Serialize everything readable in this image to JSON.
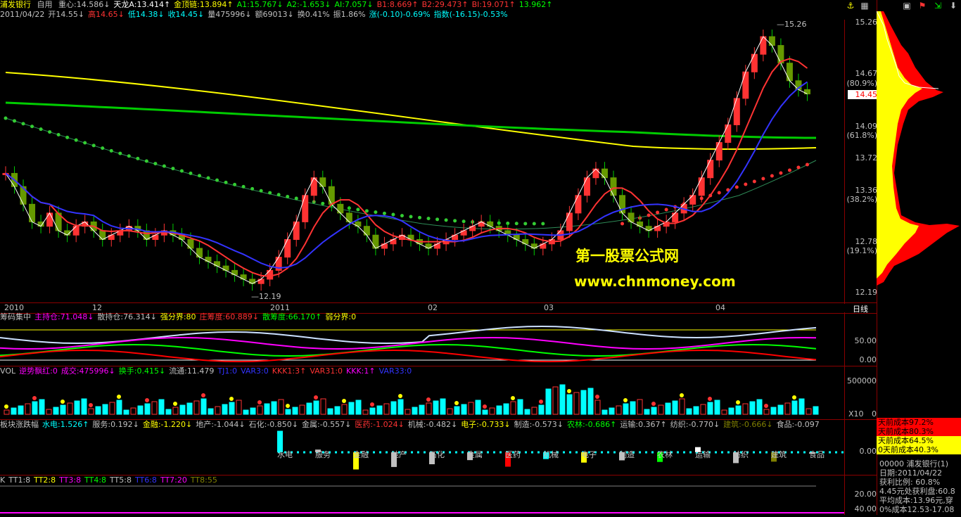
{
  "header1": {
    "stock_name": "浦发银行",
    "tab": "自用",
    "items": [
      {
        "label": "重心:14.586",
        "arrow": "↓",
        "color": "#c0c0c0"
      },
      {
        "label": "天龙A:13.414",
        "arrow": "↑",
        "color": "#ffffff"
      },
      {
        "label": "金顶链:13.894",
        "arrow": "↑",
        "color": "#ffff00"
      },
      {
        "label": "A1:15.767",
        "arrow": "↓",
        "color": "#00ff00"
      },
      {
        "label": "A2:-1.653",
        "arrow": "↓",
        "color": "#00ff00"
      },
      {
        "label": "AI:7.057",
        "arrow": "↓",
        "color": "#00ff00"
      },
      {
        "label": "B1:8.669",
        "arrow": "↑",
        "color": "#ff3333"
      },
      {
        "label": "B2:29.473",
        "arrow": "↑",
        "color": "#ff3333"
      },
      {
        "label": "BI:19.071",
        "arrow": "↑",
        "color": "#ff3333"
      },
      {
        "label": "13.962",
        "arrow": "↑",
        "color": "#00ff00"
      }
    ]
  },
  "header2": {
    "items": [
      {
        "label": "2011/04/22",
        "color": "#c0c0c0"
      },
      {
        "label": "开14.55↓",
        "color": "#c0c0c0"
      },
      {
        "label": "高14.65↓",
        "color": "#ff3333"
      },
      {
        "label": "低14.38↓",
        "color": "#00ffff"
      },
      {
        "label": "收14.45↓",
        "color": "#00ffff"
      },
      {
        "label": "量475996↓",
        "color": "#c0c0c0"
      },
      {
        "label": "额69013↓",
        "color": "#c0c0c0"
      },
      {
        "label": "换0.41%",
        "color": "#c0c0c0"
      },
      {
        "label": "振1.86%",
        "color": "#c0c0c0"
      },
      {
        "label": "涨(-0.10)-0.69%",
        "color": "#00ffff"
      },
      {
        "label": "指数(-16.15)-0.53%",
        "color": "#00ffff"
      }
    ]
  },
  "price_axis": [
    "15.26",
    "14.67",
    "(80.9%)",
    "14.45",
    "14.09",
    "(61.8%)",
    "13.72",
    "13.36",
    "(38.2%)",
    "12.78",
    "(19.1%)",
    "12.19"
  ],
  "price_markers": {
    "high": "15.26",
    "low": "12.19"
  },
  "date_axis": [
    "2010",
    "12",
    "2011",
    "02",
    "03",
    "04"
  ],
  "period_label": "日线",
  "watermark": {
    "line1": "第一股票公式网",
    "line2": "www.chnmoney.com"
  },
  "indicator1": {
    "items": [
      {
        "label": "筹码集中",
        "color": "#c0c0c0"
      },
      {
        "label": "主持仓:71.048↓",
        "color": "#ff00ff"
      },
      {
        "label": "散持仓:76.314↓",
        "color": "#c0c0c0"
      },
      {
        "label": "强分界:80",
        "color": "#ffff00"
      },
      {
        "label": "庄筹度:60.889↓",
        "color": "#ff3333"
      },
      {
        "label": "散筹度:66.170↑",
        "color": "#00ff00"
      },
      {
        "label": "弱分界:0",
        "color": "#ffff00"
      }
    ],
    "axis": [
      "50.00",
      "0.00"
    ]
  },
  "indicator2": {
    "items": [
      {
        "label": "VOL",
        "color": "#c0c0c0"
      },
      {
        "label": "逆势飘红:0",
        "color": "#ff00ff"
      },
      {
        "label": "成交:475996↓",
        "color": "#ff00ff"
      },
      {
        "label": "换手:0.415↓",
        "color": "#00ff00"
      },
      {
        "label": "流通:11.479",
        "color": "#c0c0c0"
      },
      {
        "label": "TJ1:0",
        "color": "#3333ff"
      },
      {
        "label": "VAR3:0",
        "color": "#3333ff"
      },
      {
        "label": "KKK1:3↑",
        "color": "#ff3333"
      },
      {
        "label": "VAR31:0",
        "color": "#ff3333"
      },
      {
        "label": "KKK:1↑",
        "color": "#ff00ff"
      },
      {
        "label": "VAR33:0",
        "color": "#3333ff"
      }
    ],
    "axis_top": "500000",
    "axis_unit": "X10",
    "axis_bottom": "0"
  },
  "indicator3": {
    "items": [
      {
        "label": "板块涨跌幅",
        "color": "#c0c0c0"
      },
      {
        "label": "水电:1.526↑",
        "color": "#00ffff"
      },
      {
        "label": "服务:0.192↓",
        "color": "#c0c0c0"
      },
      {
        "label": "金融:-1.220↓",
        "color": "#ffff00"
      },
      {
        "label": "地产:-1.044↓",
        "color": "#c0c0c0"
      },
      {
        "label": "石化:-0.850↓",
        "color": "#c0c0c0"
      },
      {
        "label": "金属:-0.557↓",
        "color": "#c0c0c0"
      },
      {
        "label": "医药:-1.024↓",
        "color": "#ff3333"
      },
      {
        "label": "机械:-0.482↓",
        "color": "#c0c0c0"
      },
      {
        "label": "电子:-0.733↓",
        "color": "#ffff00"
      },
      {
        "label": "制造:-0.573↓",
        "color": "#c0c0c0"
      },
      {
        "label": "农林:-0.686↑",
        "color": "#00ff00"
      },
      {
        "label": "运输:0.367↑",
        "color": "#c0c0c0"
      },
      {
        "label": "纺织:-0.770↓",
        "color": "#c0c0c0"
      },
      {
        "label": "建筑:-0.666↓",
        "color": "#808000"
      },
      {
        "label": "食品:-0.097",
        "color": "#c0c0c0"
      }
    ],
    "sectors": [
      {
        "name": "水电",
        "value": 1.526,
        "color": "#00ffff"
      },
      {
        "name": "服务",
        "value": 0.192,
        "color": "#c0c0c0"
      },
      {
        "name": "金融",
        "value": -1.22,
        "color": "#ffff00"
      },
      {
        "name": "地产",
        "value": -1.044,
        "color": "#c0c0c0"
      },
      {
        "name": "石化",
        "value": -0.85,
        "color": "#c0c0c0"
      },
      {
        "name": "金属",
        "value": -0.557,
        "color": "#c0c0c0"
      },
      {
        "name": "医药",
        "value": -1.024,
        "color": "#ff0000"
      },
      {
        "name": "机械",
        "value": -0.482,
        "color": "#00ffff"
      },
      {
        "name": "电子",
        "value": -0.733,
        "color": "#ffff00"
      },
      {
        "name": "制造",
        "value": -0.573,
        "color": "#c0c0c0"
      },
      {
        "name": "农林",
        "value": -0.686,
        "color": "#00ff00"
      },
      {
        "name": "运输",
        "value": 0.367,
        "color": "#ffffff"
      },
      {
        "name": "纺织",
        "value": -0.77,
        "color": "#c0c0c0"
      },
      {
        "name": "建筑",
        "value": -0.666,
        "color": "#808000"
      },
      {
        "name": "食品",
        "value": -0.097,
        "color": "#c0c0c0"
      }
    ],
    "axis": "0.00"
  },
  "indicator4": {
    "items": [
      {
        "label": "K",
        "color": "#c0c0c0"
      },
      {
        "label": "TT1:8",
        "color": "#c0c0c0"
      },
      {
        "label": "TT2:8",
        "color": "#ffff00"
      },
      {
        "label": "TT3:8",
        "color": "#ff00ff"
      },
      {
        "label": "TT4:8",
        "color": "#00ff00"
      },
      {
        "label": "TT5:8",
        "color": "#c0c0c0"
      },
      {
        "label": "TT6:8",
        "color": "#3333ff"
      },
      {
        "label": "TT7:20",
        "color": "#ff00ff"
      },
      {
        "label": "TT8:55",
        "color": "#808000"
      }
    ],
    "axis": [
      "20.00",
      "40.00"
    ]
  },
  "right_panel": {
    "cost_rows": [
      {
        "label": "天前成本97.2%",
        "bg": "#ff0000"
      },
      {
        "label": "天前成本80.3%",
        "bg": "#ff0000"
      },
      {
        "label": "天前成本64.5%",
        "bg": "#ffff00"
      },
      {
        "label": "0天前成本40.3%",
        "bg": "#ffff00"
      }
    ],
    "info_lines": [
      "00000 浦发银行(1)",
      "日期:2011/04/22",
      "获利比例: 60.8%",
      "4.45元处获利盘:60.8",
      "平均成本:13.96元,穿",
      "0%成本12.53-17.08"
    ]
  },
  "toolbar_icons": [
    "anchor-icon",
    "grid-icon",
    "flag-icon",
    "arrows-icon",
    "arrow-down-icon"
  ]
}
